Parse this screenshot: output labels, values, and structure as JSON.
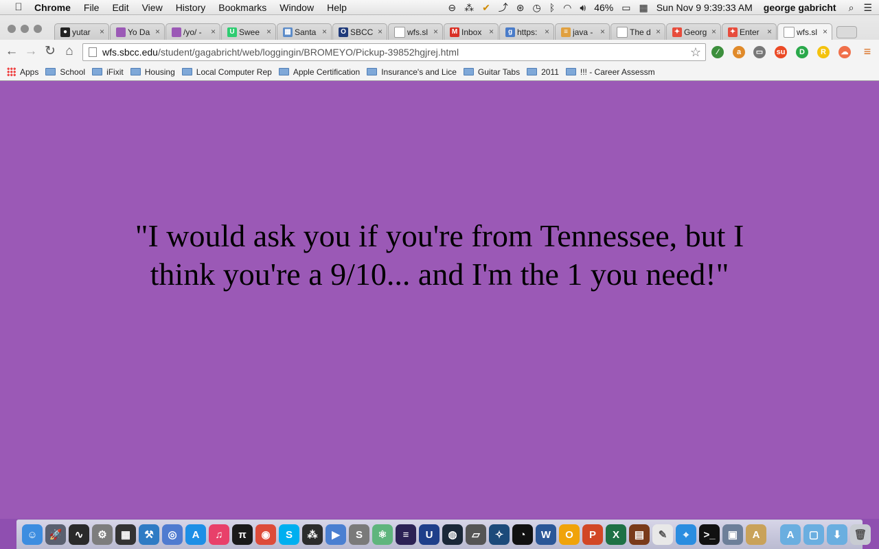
{
  "menubar": {
    "app": "Chrome",
    "menus": [
      "File",
      "Edit",
      "View",
      "History",
      "Bookmarks",
      "Window",
      "Help"
    ],
    "battery": "46%",
    "datetime": "Sun Nov 9  9:39:33 AM",
    "user": "george gabricht"
  },
  "tabs": [
    {
      "title": "yutar",
      "fav_color": "#222222",
      "fav_glyph": "●"
    },
    {
      "title": "Yo Da",
      "fav_color": "#9b59b6",
      "fav_glyph": ""
    },
    {
      "title": "/yo/ -",
      "fav_color": "#9b59b6",
      "fav_glyph": ""
    },
    {
      "title": "Swee",
      "fav_color": "#2ecc71",
      "fav_glyph": "U"
    },
    {
      "title": "Santa",
      "fav_color": "#5d8cc9",
      "fav_glyph": "▦"
    },
    {
      "title": "SBCC",
      "fav_color": "#1f3a7a",
      "fav_glyph": "O"
    },
    {
      "title": "wfs.sl",
      "fav_color": "#ffffff",
      "fav_glyph": ""
    },
    {
      "title": "Inbox",
      "fav_color": "#d93025",
      "fav_glyph": "M"
    },
    {
      "title": "https:",
      "fav_color": "#4a7cc9",
      "fav_glyph": "g"
    },
    {
      "title": "java -",
      "fav_color": "#e0a040",
      "fav_glyph": "≡"
    },
    {
      "title": "The d",
      "fav_color": "#ffffff",
      "fav_glyph": ""
    },
    {
      "title": "Georg",
      "fav_color": "#e74c3c",
      "fav_glyph": "✦"
    },
    {
      "title": "Enter",
      "fav_color": "#e74c3c",
      "fav_glyph": "✦"
    },
    {
      "title": "wfs.sl",
      "fav_color": "#ffffff",
      "fav_glyph": "",
      "active": true
    }
  ],
  "omnibox": {
    "host": "wfs.sbcc.edu",
    "path": "/student/gagabricht/web/loggingin/BROMEYO/Pickup-39852hgjrej.html"
  },
  "bookmarks": [
    {
      "label": "Apps",
      "kind": "apps"
    },
    {
      "label": "School",
      "kind": "folder"
    },
    {
      "label": "iFixit",
      "kind": "folder"
    },
    {
      "label": "Housing",
      "kind": "folder"
    },
    {
      "label": "Local Computer Rep",
      "kind": "folder"
    },
    {
      "label": "Apple Certification",
      "kind": "folder"
    },
    {
      "label": "Insurance's and Lice",
      "kind": "folder"
    },
    {
      "label": "Guitar Tabs",
      "kind": "folder"
    },
    {
      "label": "2011",
      "kind": "folder"
    },
    {
      "label": "!!! - Career Assessm",
      "kind": "folder"
    }
  ],
  "extensions": [
    {
      "name": "eyedropper-extension-icon",
      "color": "#3c8f3c",
      "glyph": "⁄"
    },
    {
      "name": "amazon-extension-icon",
      "color": "#e08a2a",
      "glyph": "a"
    },
    {
      "name": "cast-icon",
      "color": "#777777",
      "glyph": "▭"
    },
    {
      "name": "stumbleupon-icon",
      "color": "#eb4924",
      "glyph": "su"
    },
    {
      "name": "extension-d-icon",
      "color": "#2aa84a",
      "glyph": "D"
    },
    {
      "name": "extension-r-icon",
      "color": "#f4c20d",
      "glyph": "R"
    },
    {
      "name": "extension-cloud-icon",
      "color": "#f0704a",
      "glyph": "☁"
    }
  ],
  "page": {
    "quote": "\"I would ask you if you're from Tennessee, but I think you're a 9/10... and I'm the 1 you need!\"",
    "background": "#9b59b6"
  },
  "dock": [
    {
      "name": "finder-icon",
      "color": "#3d8de0",
      "glyph": "☺"
    },
    {
      "name": "launchpad-icon",
      "color": "#5a6070",
      "glyph": "🚀"
    },
    {
      "name": "activity-monitor-icon",
      "color": "#2a2a2a",
      "glyph": "∿"
    },
    {
      "name": "system-preferences-icon",
      "color": "#7d7d7d",
      "glyph": "⚙"
    },
    {
      "name": "app-icon-5",
      "color": "#333333",
      "glyph": "▦"
    },
    {
      "name": "xcode-icon",
      "color": "#2f7bc4",
      "glyph": "⚒"
    },
    {
      "name": "network-utility-icon",
      "color": "#4f7bd0",
      "glyph": "◎"
    },
    {
      "name": "app-store-icon",
      "color": "#1d8fe6",
      "glyph": "A"
    },
    {
      "name": "itunes-icon",
      "color": "#e8406a",
      "glyph": "♫"
    },
    {
      "name": "pi-app-icon",
      "color": "#1a1a1a",
      "glyph": "π"
    },
    {
      "name": "chrome-icon",
      "color": "#dd4b39",
      "glyph": "◉"
    },
    {
      "name": "skype-icon",
      "color": "#00aff0",
      "glyph": "S"
    },
    {
      "name": "app-icon-13",
      "color": "#2c2c2c",
      "glyph": "⁂"
    },
    {
      "name": "quicktime-icon",
      "color": "#4a7fd1",
      "glyph": "▶"
    },
    {
      "name": "sublime-text-icon",
      "color": "#7a7a7a",
      "glyph": "S"
    },
    {
      "name": "atom-icon",
      "color": "#5fb57d",
      "glyph": "⚛"
    },
    {
      "name": "eclipse-icon",
      "color": "#2c2255",
      "glyph": "≡"
    },
    {
      "name": "unreal-engine-icon",
      "color": "#1e3f8a",
      "glyph": "U"
    },
    {
      "name": "steam-icon",
      "color": "#1b2838",
      "glyph": "◍"
    },
    {
      "name": "app-icon-20",
      "color": "#555555",
      "glyph": "▱"
    },
    {
      "name": "app-icon-21",
      "color": "#1c4a7a",
      "glyph": "✧"
    },
    {
      "name": "app-icon-22",
      "color": "#111111",
      "glyph": "◔"
    },
    {
      "name": "word-icon",
      "color": "#2b5797",
      "glyph": "W"
    },
    {
      "name": "outlook-icon",
      "color": "#f0a30a",
      "glyph": "O"
    },
    {
      "name": "powerpoint-icon",
      "color": "#d24726",
      "glyph": "P"
    },
    {
      "name": "excel-icon",
      "color": "#1e7145",
      "glyph": "X"
    },
    {
      "name": "app-icon-27",
      "color": "#7a3a1a",
      "glyph": "▤"
    },
    {
      "name": "textedit-icon",
      "color": "#e8e8e8",
      "glyph": "✎"
    },
    {
      "name": "safari-icon",
      "color": "#2a8de0",
      "glyph": "⌖"
    },
    {
      "name": "terminal-icon",
      "color": "#111111",
      "glyph": ">_"
    },
    {
      "name": "app-icon-31",
      "color": "#6d7f99",
      "glyph": "▣"
    },
    {
      "name": "app-icon-32",
      "color": "#c9a25a",
      "glyph": "A"
    },
    {
      "name": "applications-folder-icon",
      "color": "#6aaee0",
      "glyph": "A"
    },
    {
      "name": "documents-folder-icon",
      "color": "#6aaee0",
      "glyph": "▢"
    },
    {
      "name": "downloads-folder-icon",
      "color": "#6aaee0",
      "glyph": "⬇"
    },
    {
      "name": "trash-icon",
      "color": "#c8ccd2",
      "glyph": "🗑"
    }
  ]
}
